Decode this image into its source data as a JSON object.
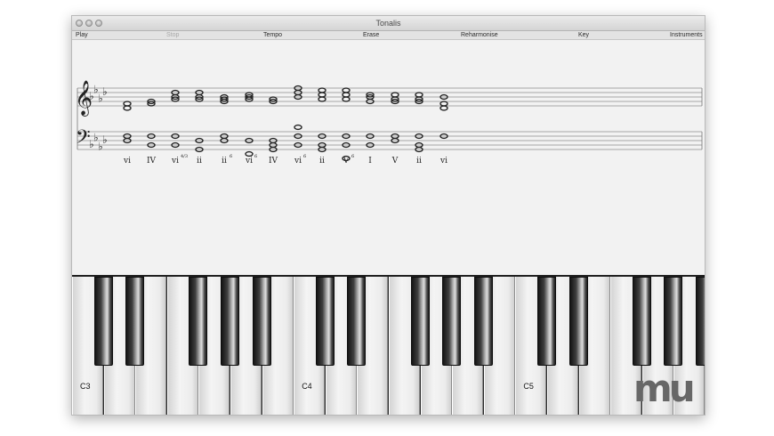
{
  "window": {
    "title": "Tonalis"
  },
  "toolbar": {
    "items": [
      {
        "label": "Play",
        "enabled": true
      },
      {
        "label": "Stop",
        "enabled": false
      },
      {
        "label": "Tempo",
        "enabled": true
      },
      {
        "label": "Erase",
        "enabled": true
      },
      {
        "label": "Reharmonise",
        "enabled": true
      },
      {
        "label": "Key",
        "enabled": true
      },
      {
        "label": "Instruments",
        "enabled": true
      }
    ]
  },
  "score": {
    "treble_clef_icon": "treble-clef-icon",
    "bass_clef_icon": "bass-clef-icon",
    "key_signature": "Ab major / F minor (4 flats)",
    "chords": [
      {
        "numeral": "vi",
        "inversion": ""
      },
      {
        "numeral": "IV",
        "inversion": ""
      },
      {
        "numeral": "vi",
        "inversion": "4/3"
      },
      {
        "numeral": "ii",
        "inversion": ""
      },
      {
        "numeral": "ii",
        "inversion": "6"
      },
      {
        "numeral": "vi",
        "inversion": "6"
      },
      {
        "numeral": "IV",
        "inversion": ""
      },
      {
        "numeral": "vi",
        "inversion": "6"
      },
      {
        "numeral": "ii",
        "inversion": ""
      },
      {
        "numeral": "V",
        "inversion": "6"
      },
      {
        "numeral": "I",
        "inversion": ""
      },
      {
        "numeral": "V",
        "inversion": ""
      },
      {
        "numeral": "ii",
        "inversion": ""
      },
      {
        "numeral": "vi",
        "inversion": ""
      }
    ]
  },
  "keyboard": {
    "octave_labels": [
      "C3",
      "C4",
      "C5"
    ]
  },
  "watermark": {
    "text": "mu",
    "icon": "macupdate-logo-icon"
  }
}
